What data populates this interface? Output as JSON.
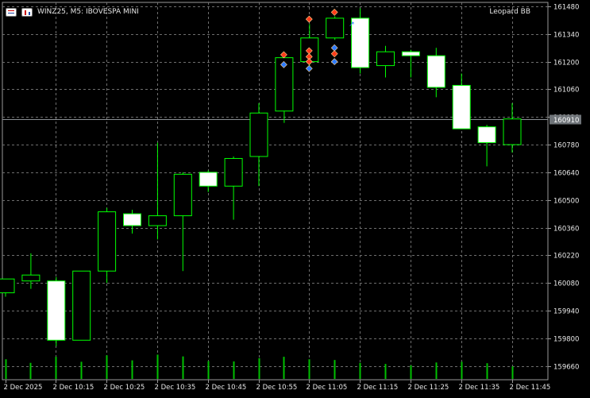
{
  "header": {
    "symbol_info": "WINZ25, M5:  IBOVESPA MINI",
    "icon_left": "table-icon",
    "icon_right": "bar-chart-icon"
  },
  "indicator_label": "Leopard BB",
  "current_price_label": "160910",
  "colors": {
    "background": "#000000",
    "grid": "#6e6e6e",
    "bull_fill": "#000000",
    "bear_fill": "#ffffff",
    "candle_border": "#00ff00",
    "volume": "#00c000",
    "price_line": "#8a8f94",
    "price_tag_bg": "#6f7479",
    "axis_text": "#e6e6e6",
    "marker_red": "#ff3b1a",
    "marker_blue": "#2d7bff"
  },
  "chart_data": {
    "type": "candlestick",
    "title": "",
    "y_ticks": [
      "161480",
      "161340",
      "161200",
      "161060",
      "160920",
      "160780",
      "160640",
      "160500",
      "160360",
      "160220",
      "160080",
      "159940",
      "159800",
      "159660"
    ],
    "x_ticks": [
      "2 Dec 2025",
      "2 Dec 10:15",
      "2 Dec 10:25",
      "2 Dec 10:35",
      "2 Dec 10:45",
      "2 Dec 10:55",
      "2 Dec 11:05",
      "2 Dec 11:15",
      "2 Dec 11:25",
      "2 Dec 11:35",
      "2 Dec 11:45"
    ],
    "ylim": [
      159590,
      161500
    ],
    "current_price": 160910,
    "candles": [
      {
        "open": 160030,
        "high": 160100,
        "low": 160010,
        "close": 160100
      },
      {
        "open": 160090,
        "high": 160230,
        "low": 160050,
        "close": 160120
      },
      {
        "open": 160090,
        "high": 160110,
        "low": 159760,
        "close": 159790
      },
      {
        "open": 159790,
        "high": 160140,
        "low": 159790,
        "close": 160140
      },
      {
        "open": 160140,
        "high": 160460,
        "low": 160080,
        "close": 160440
      },
      {
        "open": 160430,
        "high": 160450,
        "low": 160330,
        "close": 160370
      },
      {
        "open": 160370,
        "high": 160790,
        "low": 160300,
        "close": 160420
      },
      {
        "open": 160420,
        "high": 160640,
        "low": 160140,
        "close": 160630
      },
      {
        "open": 160640,
        "high": 160650,
        "low": 160540,
        "close": 160570
      },
      {
        "open": 160570,
        "high": 160720,
        "low": 160400,
        "close": 160710
      },
      {
        "open": 160720,
        "high": 160990,
        "low": 160570,
        "close": 160940
      },
      {
        "open": 160950,
        "high": 161250,
        "low": 160890,
        "close": 161220
      },
      {
        "open": 161200,
        "high": 161390,
        "low": 161180,
        "close": 161320
      },
      {
        "open": 161320,
        "high": 161430,
        "low": 161310,
        "close": 161420
      },
      {
        "open": 161420,
        "high": 161470,
        "low": 161140,
        "close": 161170
      },
      {
        "open": 161180,
        "high": 161280,
        "low": 161120,
        "close": 161250
      },
      {
        "open": 161250,
        "high": 161260,
        "low": 161120,
        "close": 161230
      },
      {
        "open": 161230,
        "high": 161270,
        "low": 161020,
        "close": 161070
      },
      {
        "open": 161080,
        "high": 161140,
        "low": 160880,
        "close": 160860
      },
      {
        "open": 160870,
        "high": 160880,
        "low": 160670,
        "close": 160790
      },
      {
        "open": 160780,
        "high": 160990,
        "low": 160740,
        "close": 160910
      }
    ],
    "volumes": [
      0.55,
      0.45,
      0.62,
      0.48,
      0.66,
      0.52,
      0.68,
      0.63,
      0.5,
      0.49,
      0.58,
      0.62,
      0.55,
      0.53,
      0.45,
      0.42,
      0.38,
      0.46,
      0.48,
      0.44,
      0.35
    ],
    "signals": [
      {
        "candle": 11,
        "price": 161235,
        "type": "sell"
      },
      {
        "candle": 11,
        "price": 161185,
        "type": "buy"
      },
      {
        "candle": 12,
        "price": 161415,
        "type": "sell"
      },
      {
        "candle": 12,
        "price": 161255,
        "type": "sell"
      },
      {
        "candle": 12,
        "price": 161225,
        "type": "sell"
      },
      {
        "candle": 12,
        "price": 161200,
        "type": "sell"
      },
      {
        "candle": 12,
        "price": 161165,
        "type": "buy"
      },
      {
        "candle": 13,
        "price": 161450,
        "type": "sell"
      },
      {
        "candle": 13,
        "price": 161270,
        "type": "buy"
      },
      {
        "candle": 13,
        "price": 161240,
        "type": "sell"
      },
      {
        "candle": 13,
        "price": 161200,
        "type": "buy"
      },
      {
        "candle": 14,
        "price": 161395,
        "type": "small"
      }
    ]
  }
}
